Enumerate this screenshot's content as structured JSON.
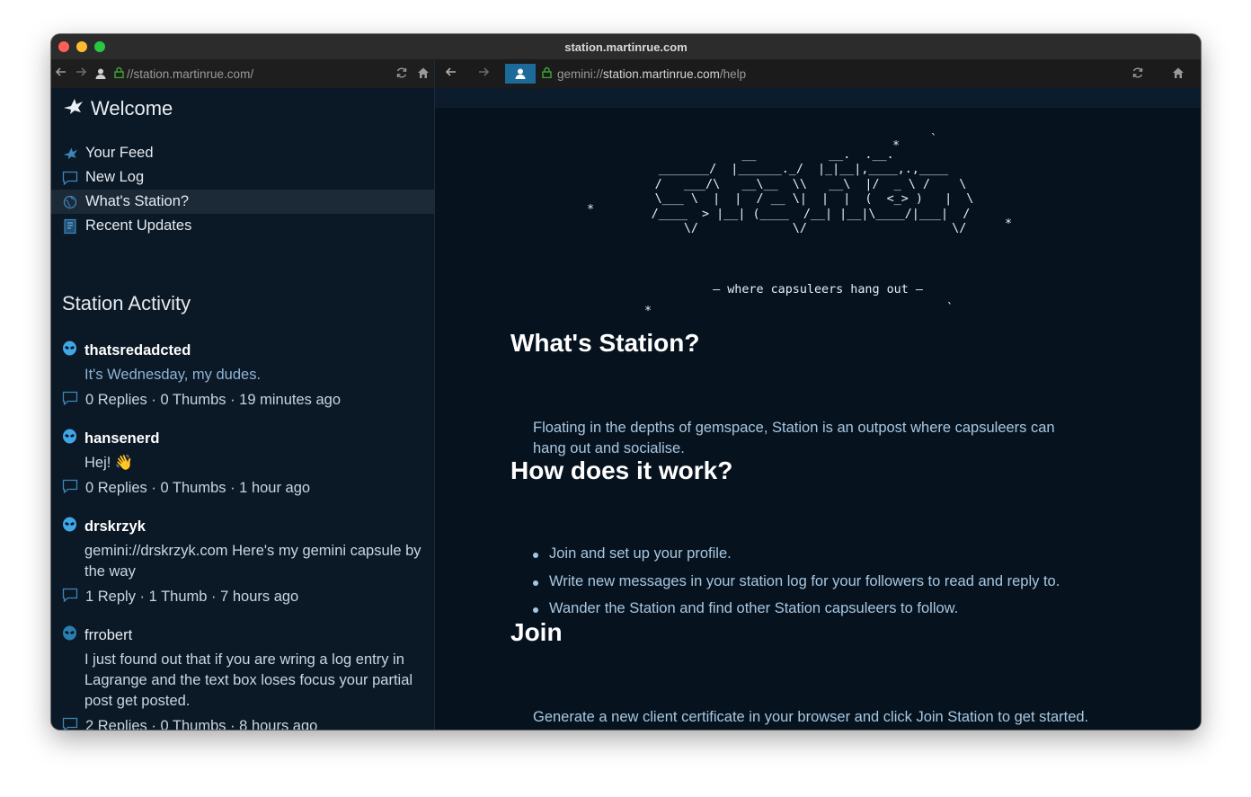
{
  "window": {
    "title": "station.martinrue.com"
  },
  "left_pane": {
    "url": {
      "prefix": "//",
      "host": "station.martinrue.com",
      "path": "/"
    },
    "welcome": "Welcome",
    "menu": [
      {
        "label": "Your Feed",
        "icon": "bird-icon"
      },
      {
        "label": "New Log",
        "icon": "chat-bubble-icon"
      },
      {
        "label": "What's Station?",
        "icon": "globe-icon",
        "selected": true
      },
      {
        "label": "Recent Updates",
        "icon": "notebook-icon"
      }
    ],
    "activity_title": "Station Activity",
    "posts": [
      {
        "user": "thatsredadcted",
        "body": "It's Wednesday, my dudes.",
        "meta": "0 Replies · 0 Thumbs · 19 minutes ago"
      },
      {
        "user": "hansenerd",
        "body": "Hej! 👋",
        "meta": "0 Replies · 0 Thumbs · 1 hour ago"
      },
      {
        "user": "drskrzyk",
        "body": "gemini://drskrzyk.com Here's my gemini capsule by the way",
        "meta": "1 Reply · 1 Thumb · 7 hours ago"
      },
      {
        "user": "frrobert",
        "body": "I just found out that if you are wring a log entry in Lagrange and the text box loses focus your partial post get posted.",
        "meta": "2 Replies · 0 Thumbs · 8 hours ago"
      }
    ]
  },
  "right_pane": {
    "url": {
      "scheme": "gemini://",
      "host": "station.martinrue.com",
      "path": "/help"
    },
    "ascii_art": "                                `\n                   __          __.  .__.                   \n   _______/  |______._/  |_|__|,____,.,____       \n   /   ___/\\   __\\__  \\\\   __\\  |/  _ \\ /    \\     \n   \\___ \\  |  |  / __ \\|  |  |  (  <_> )   |  \\    \n  /____  > |__| (____  /__| |__|\\____/|___|  /    \n       \\/             \\/                    \\/     ",
    "tagline": "– where capsuleers hang out –",
    "sections": [
      {
        "heading": "What's Station?",
        "text": "Floating in the depths of gemspace, Station is an outpost where capsuleers can hang out and socialise."
      },
      {
        "heading": "How does it work?",
        "bullets": [
          "Join and set up your profile.",
          "Write new messages in your station log for your followers to read and reply to.",
          "Wander the Station and find other Station capsuleers to follow."
        ]
      },
      {
        "heading": "Join",
        "text": "Generate a new client certificate in your browser and click Join Station to get started."
      }
    ]
  },
  "colors": {
    "accent": "#1b6a9a",
    "link": "#8fb4d4",
    "background": "#06131f"
  }
}
